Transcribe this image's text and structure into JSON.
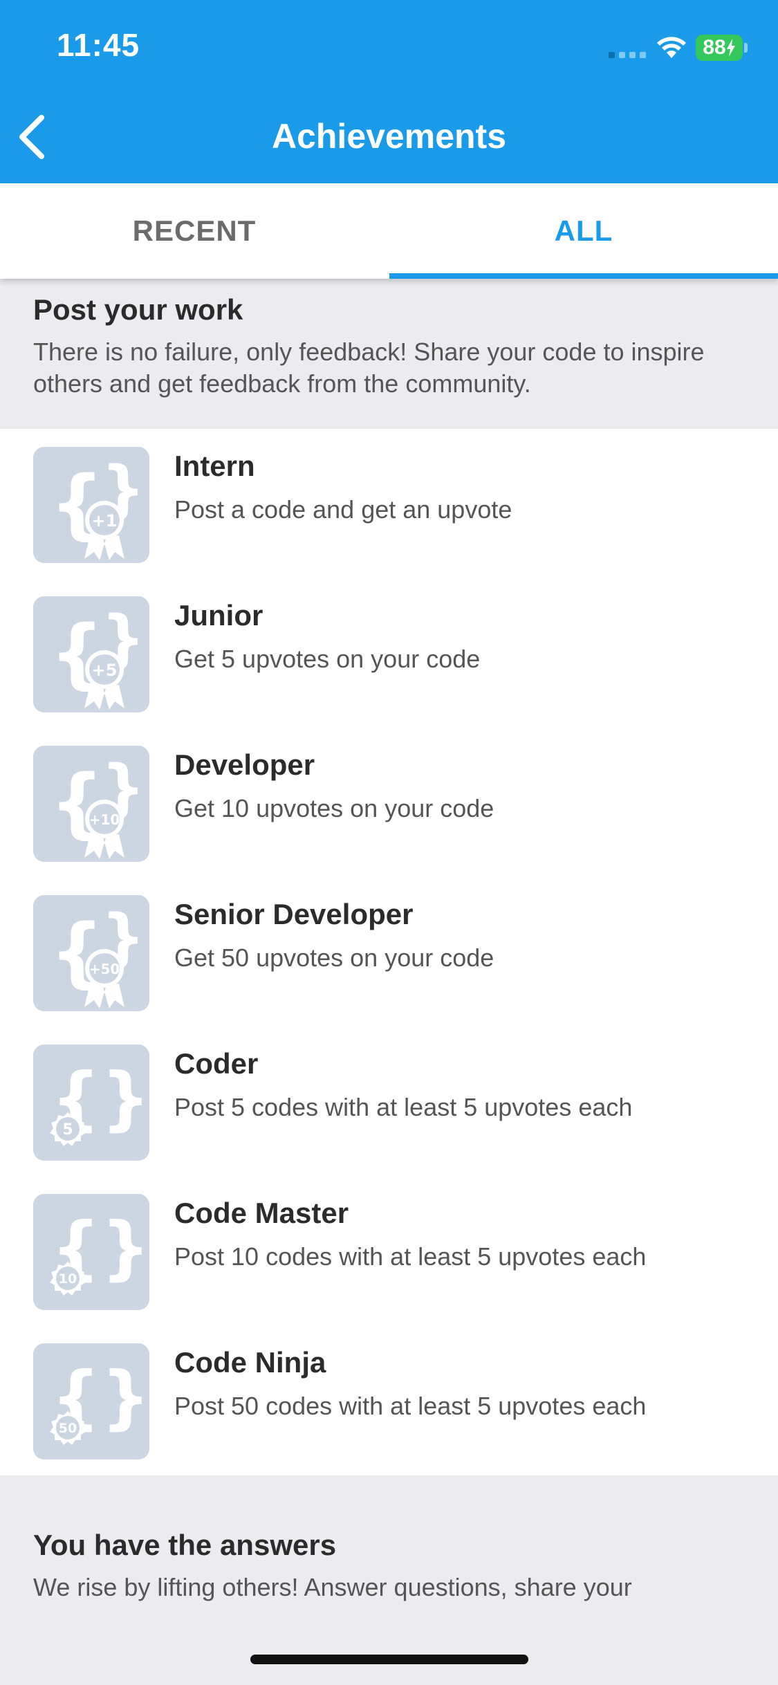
{
  "status_bar": {
    "time": "11:45",
    "battery": "88"
  },
  "header": {
    "title": "Achievements"
  },
  "tabs": [
    {
      "label": "RECENT"
    },
    {
      "label": "ALL"
    }
  ],
  "sections": [
    {
      "title": "Post your work",
      "description": "There is no failure, only feedback! Share your code to inspire others and get feedback from the community."
    },
    {
      "title": "You have the answers",
      "description": "We rise by lifting others! Answer questions, share your"
    }
  ],
  "achievements": [
    {
      "title": "Intern",
      "description": "Post a code and get an upvote",
      "badge_text": "+1",
      "badge_style": "ribbon"
    },
    {
      "title": "Junior",
      "description": "Get 5 upvotes on your code",
      "badge_text": "+5",
      "badge_style": "ribbon"
    },
    {
      "title": "Developer",
      "description": "Get 10 upvotes on your code",
      "badge_text": "+10",
      "badge_style": "ribbon"
    },
    {
      "title": "Senior Developer",
      "description": "Get 50 upvotes on your code",
      "badge_text": "+50",
      "badge_style": "ribbon"
    },
    {
      "title": "Coder",
      "description": "Post 5 codes with at least 5 upvotes each",
      "badge_text": "5",
      "badge_style": "seal"
    },
    {
      "title": "Code Master",
      "description": "Post 10 codes with at least 5 upvotes each",
      "badge_text": "10",
      "badge_style": "seal"
    },
    {
      "title": "Code Ninja",
      "description": "Post 50 codes with at least 5 upvotes each",
      "badge_text": "50",
      "badge_style": "seal"
    }
  ],
  "colors": {
    "primary": "#1a9bea",
    "badge_bg": "#cbd6e2",
    "battery": "#34c759"
  }
}
